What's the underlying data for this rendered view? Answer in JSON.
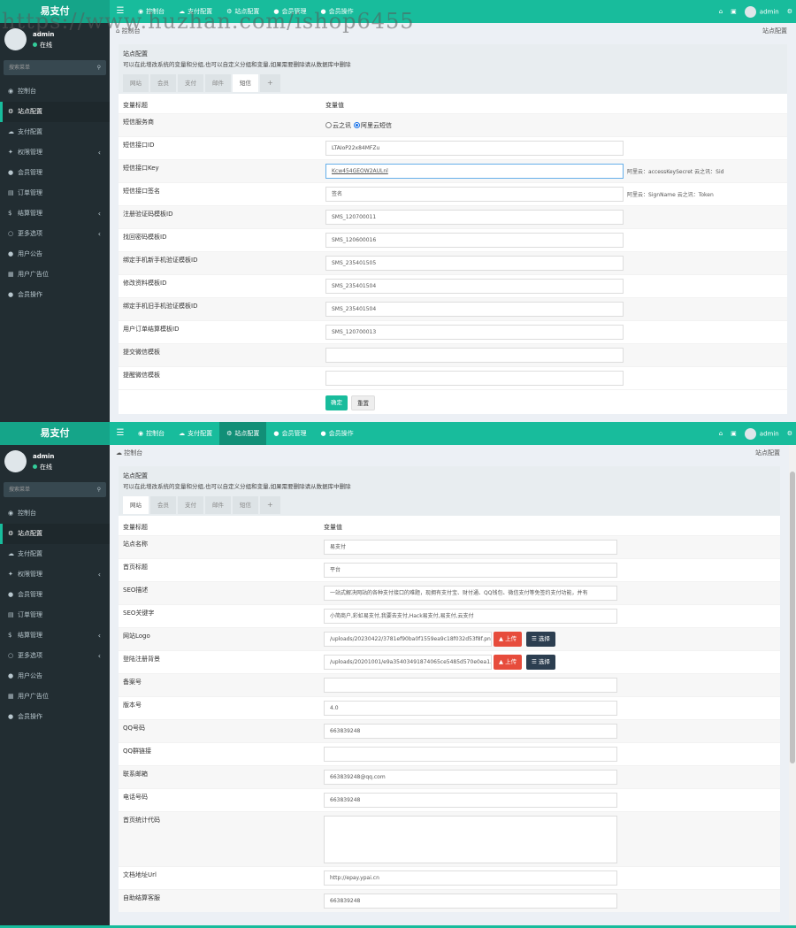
{
  "brand": "易支付",
  "watermark": "https://www.huzhan.com/ishop6455",
  "topnav": {
    "items": [
      {
        "label": "控制台"
      },
      {
        "label": "支付配置"
      },
      {
        "label": "站点配置"
      },
      {
        "label": "会员管理"
      },
      {
        "label": "会员操作"
      }
    ],
    "user": "admin"
  },
  "user_panel": {
    "name": "admin",
    "status": "在线"
  },
  "search_placeholder": "搜索菜单",
  "sidebar": [
    {
      "label": "控制台"
    },
    {
      "label": "站点配置"
    },
    {
      "label": "支付配置"
    },
    {
      "label": "权限管理"
    },
    {
      "label": "会员管理"
    },
    {
      "label": "订单管理"
    },
    {
      "label": "结算管理"
    },
    {
      "label": "更多选项"
    },
    {
      "label": "用户公告"
    },
    {
      "label": "用户广告位"
    },
    {
      "label": "会员操作"
    }
  ],
  "shot1": {
    "crumb": "控制台",
    "crumb_right": "站点配置",
    "panel_title": "站点配置",
    "panel_desc": "可以在此增改系统的变量和分组,也可以自定义分组和变量,如果需要删除请从数据库中删除",
    "tabs": [
      "网站",
      "会员",
      "支付",
      "邮件",
      "短信",
      "+"
    ],
    "col1": "变量标题",
    "col2": "变量值",
    "radio_label": "短信服务商",
    "radio_a": "云之讯",
    "radio_b": "阿里云短信",
    "rows": [
      {
        "label": "短信接口ID",
        "value": "LTAIoP22x84MFZu"
      },
      {
        "label": "短信接口Key",
        "value": "Kcw454GEOW2AULnl"
      },
      {
        "label": "短信接口签名",
        "value": "签名"
      },
      {
        "label": "注册验证码模板ID",
        "value": "SMS_120700011"
      },
      {
        "label": "找回密码模板ID",
        "value": "SMS_120600016"
      },
      {
        "label": "绑定手机新手机验证模板ID",
        "value": "SMS_235401505"
      },
      {
        "label": "修改资料模板ID",
        "value": "SMS_235401504"
      },
      {
        "label": "绑定手机旧手机验证模板ID",
        "value": "SMS_235401504"
      },
      {
        "label": "用户订单结算模板ID",
        "value": "SMS_120700013"
      },
      {
        "label": "提交微信模板",
        "value": ""
      },
      {
        "label": "提醒微信模板",
        "value": ""
      }
    ],
    "hint_key": "阿里云：accessKeySecret 云之讯：Sid",
    "hint_sign": "阿里云：SignName 云之讯：Token",
    "btn_ok": "确定",
    "btn_reset": "重置"
  },
  "shot2": {
    "crumb": "控制台",
    "crumb_right": "站点配置",
    "panel_title": "站点配置",
    "panel_desc": "可以在此增改系统的变量和分组,也可以自定义分组和变量,如果需要删除请从数据库中删除",
    "tabs": [
      "网站",
      "会员",
      "支付",
      "邮件",
      "短信",
      "+"
    ],
    "col1": "变量标题",
    "col2": "变量值",
    "rows": [
      {
        "label": "站点名称",
        "value": "易支付"
      },
      {
        "label": "首页标题",
        "value": "平台"
      },
      {
        "label": "SEO描述",
        "value": "一站式解决网站的各种支付接口的难题，现拥有支付宝、财付通、QQ钱包、微信支付等免签约支付功能，并有"
      },
      {
        "label": "SEO关键字",
        "value": "小简商户,彩虹易支付,我要去支付,Hack易支付,易支付,云支付"
      },
      {
        "label": "网站Logo",
        "value": "/uploads/20230422/3781ef90ba0f1559ea9c18f032d53f8f.png"
      },
      {
        "label": "登陆注册背景",
        "value": "/uploads/20201001/e9a35403491874065ce5485d570e0ea1.jpg"
      },
      {
        "label": "备案号",
        "value": ""
      },
      {
        "label": "版本号",
        "value": "4.0"
      },
      {
        "label": "QQ号码",
        "value": "663839248"
      },
      {
        "label": "QQ群链接",
        "value": ""
      },
      {
        "label": "联系邮箱",
        "value": "663839248@qq.com"
      },
      {
        "label": "电话号码",
        "value": "663839248"
      },
      {
        "label": "首页统计代码",
        "value": ""
      },
      {
        "label": "文档地址Url",
        "value": "http://epay.ypai.cn"
      },
      {
        "label": "自助结算客服",
        "value": "663839248"
      }
    ],
    "btn_upload": "上传",
    "btn_select": "选择"
  }
}
